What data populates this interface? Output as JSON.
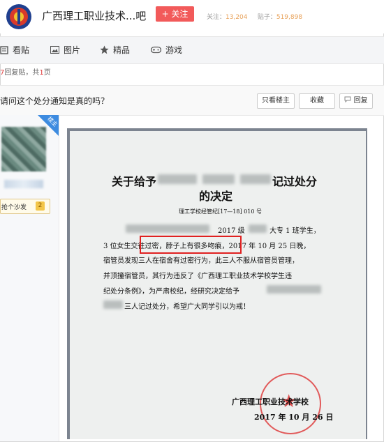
{
  "header": {
    "bar_name": "广西理工职业技术...吧",
    "follow_label": "+ 关注",
    "stats_follow_label": "关注：",
    "stats_follow_value": "13,204",
    "stats_posts_label": "贴子：",
    "stats_posts_value": "519,898"
  },
  "nav": {
    "items": [
      {
        "label": "看贴",
        "icon": "post-icon"
      },
      {
        "label": "图片",
        "icon": "image-icon"
      },
      {
        "label": "精品",
        "icon": "star-icon"
      },
      {
        "label": "游戏",
        "icon": "gamepad-icon"
      }
    ]
  },
  "reply_info": {
    "count": "7",
    "count_suffix": "回复贴，共",
    "pages": "1",
    "pages_suffix": "页"
  },
  "post": {
    "title": "请问这个处分通知是真的吗？",
    "only_op_label": "只看楼主",
    "favorite_label": "收藏",
    "reply_label": "回复"
  },
  "author": {
    "badge": "楼主",
    "level_label": "抢个沙发",
    "level": "2"
  },
  "document": {
    "title_line1": "关于给予",
    "title_line1_end": "记过处分",
    "title_line2": "的决定",
    "ref_no": "理工学校经管纪[17—18] 010 号",
    "p1_a": "2017 级",
    "p1_b": "大专 1 班学生，",
    "p2": "3 位女生交往过密，脖子上有很多吻痕，2017 年 10 月 25 日晚，",
    "p3": "宿管员发现三人在宿舍有过密行为，此三人不服从宿管员管理，",
    "p4": "并顶撞宿管员，其行为违反了《广西理工职业技术学校学生违",
    "p5": "纪处分条例》，为严肃校纪，经研究决定给予",
    "p6": "三人记过处分，希望广大同学引以为戒！",
    "signature": "广西理工职业技术学校",
    "date": "2017 年 10 月 26 日"
  }
}
